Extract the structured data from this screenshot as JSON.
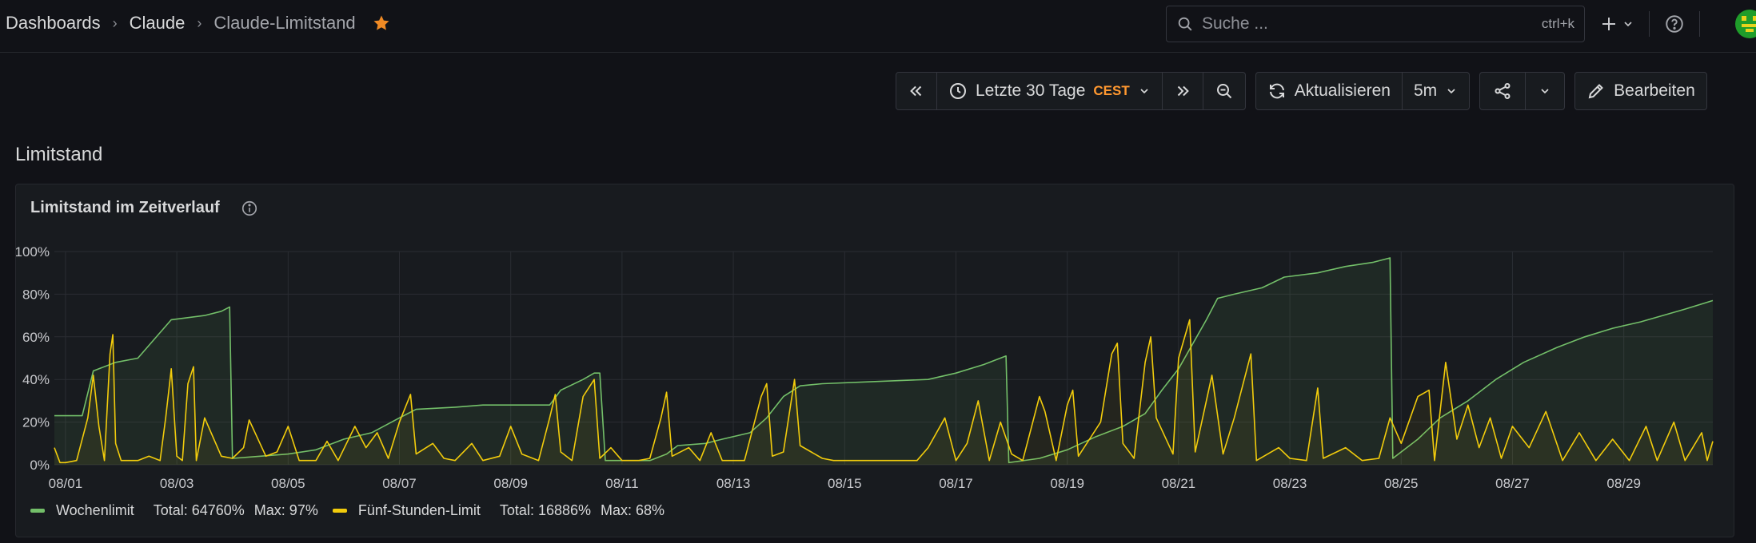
{
  "breadcrumb": {
    "home": "Dashboards",
    "folder": "Claude",
    "dashboard": "Claude-Limitstand"
  },
  "search": {
    "placeholder": "Suche ...",
    "shortcut": "ctrl+k"
  },
  "toolbar": {
    "time_range": "Letzte 30 Tage",
    "timezone": "CEST",
    "refresh_label": "Aktualisieren",
    "refresh_interval": "5m",
    "edit_label": "Bearbeiten"
  },
  "row": {
    "title": "Limitstand"
  },
  "panel": {
    "title": "Limitstand im Zeitverlauf"
  },
  "icons": [
    "search-icon",
    "plus-icon",
    "chevron-down-icon",
    "help-icon",
    "star-icon",
    "chevron-double-left-icon",
    "clock-icon",
    "chevron-double-right-icon",
    "zoom-out-icon",
    "refresh-icon",
    "share-icon",
    "pencil-icon",
    "info-icon"
  ],
  "colors": {
    "accent_star": "#f08a24",
    "timezone": "#ff9830",
    "wochenlimit": "#73bf69",
    "fuenf_stunden": "#f2cc0c"
  },
  "chart_data": {
    "type": "line",
    "y_ticks": [
      "100%",
      "80%",
      "60%",
      "40%",
      "20%",
      "0%"
    ],
    "ylim": [
      0,
      100
    ],
    "x_ticks": [
      "08/01",
      "08/03",
      "08/05",
      "08/07",
      "08/09",
      "08/11",
      "08/13",
      "08/15",
      "08/17",
      "08/19",
      "08/21",
      "08/23",
      "08/25",
      "08/27",
      "08/29"
    ],
    "xlim": [
      0.8,
      30.6
    ],
    "grid": true,
    "legend_position": "bottom-left",
    "series": [
      {
        "name": "Wochenlimit",
        "color": "#73bf69",
        "total": "Total: 64760%",
        "max": "Max: 97%",
        "points": [
          [
            0.8,
            23
          ],
          [
            1.3,
            23
          ],
          [
            1.5,
            44
          ],
          [
            1.9,
            48
          ],
          [
            2.3,
            50
          ],
          [
            2.5,
            56
          ],
          [
            2.7,
            62
          ],
          [
            2.9,
            68
          ],
          [
            3.5,
            70
          ],
          [
            3.8,
            72
          ],
          [
            3.95,
            74
          ],
          [
            4.0,
            3
          ],
          [
            4.5,
            4
          ],
          [
            5.0,
            5
          ],
          [
            5.5,
            7
          ],
          [
            6.0,
            12
          ],
          [
            6.5,
            15
          ],
          [
            7.0,
            22
          ],
          [
            7.3,
            26
          ],
          [
            8.0,
            27
          ],
          [
            8.5,
            28
          ],
          [
            9.7,
            28
          ],
          [
            9.9,
            35
          ],
          [
            10.3,
            40
          ],
          [
            10.5,
            43
          ],
          [
            10.6,
            43
          ],
          [
            10.7,
            2
          ],
          [
            11.5,
            2
          ],
          [
            11.8,
            5
          ],
          [
            12.0,
            9
          ],
          [
            12.5,
            10
          ],
          [
            12.8,
            12
          ],
          [
            13.3,
            15
          ],
          [
            13.6,
            22
          ],
          [
            13.9,
            32
          ],
          [
            14.2,
            37
          ],
          [
            14.6,
            38
          ],
          [
            15.5,
            39
          ],
          [
            16.5,
            40
          ],
          [
            17.0,
            43
          ],
          [
            17.5,
            47
          ],
          [
            17.9,
            51
          ],
          [
            17.95,
            1
          ],
          [
            18.5,
            3
          ],
          [
            19.0,
            7
          ],
          [
            19.5,
            13
          ],
          [
            20.0,
            18
          ],
          [
            20.4,
            24
          ],
          [
            20.7,
            35
          ],
          [
            21.0,
            45
          ],
          [
            21.5,
            68
          ],
          [
            21.7,
            78
          ],
          [
            22.0,
            80
          ],
          [
            22.5,
            83
          ],
          [
            22.9,
            88
          ],
          [
            23.5,
            90
          ],
          [
            24.0,
            93
          ],
          [
            24.5,
            95
          ],
          [
            24.8,
            97
          ],
          [
            24.85,
            3
          ],
          [
            25.3,
            12
          ],
          [
            25.7,
            22
          ],
          [
            26.2,
            30
          ],
          [
            26.7,
            40
          ],
          [
            27.2,
            48
          ],
          [
            27.8,
            55
          ],
          [
            28.3,
            60
          ],
          [
            28.8,
            64
          ],
          [
            29.3,
            67
          ],
          [
            29.7,
            70
          ],
          [
            30.1,
            73
          ],
          [
            30.6,
            77
          ]
        ]
      },
      {
        "name": "Fünf-Stunden-Limit",
        "color": "#f2cc0c",
        "total": "Total: 16886%",
        "max": "Max: 68%",
        "points": [
          [
            0.8,
            8
          ],
          [
            0.9,
            1
          ],
          [
            1.0,
            1
          ],
          [
            1.2,
            2
          ],
          [
            1.4,
            22
          ],
          [
            1.5,
            42
          ],
          [
            1.6,
            18
          ],
          [
            1.7,
            2
          ],
          [
            1.8,
            52
          ],
          [
            1.85,
            61
          ],
          [
            1.9,
            10
          ],
          [
            2.0,
            2
          ],
          [
            2.3,
            2
          ],
          [
            2.5,
            4
          ],
          [
            2.7,
            2
          ],
          [
            2.8,
            22
          ],
          [
            2.9,
            45
          ],
          [
            3.0,
            4
          ],
          [
            3.1,
            2
          ],
          [
            3.2,
            38
          ],
          [
            3.3,
            46
          ],
          [
            3.35,
            2
          ],
          [
            3.5,
            22
          ],
          [
            3.8,
            4
          ],
          [
            4.0,
            3
          ],
          [
            4.2,
            8
          ],
          [
            4.3,
            21
          ],
          [
            4.6,
            4
          ],
          [
            4.8,
            6
          ],
          [
            5.0,
            18
          ],
          [
            5.2,
            2
          ],
          [
            5.5,
            2
          ],
          [
            5.7,
            11
          ],
          [
            5.9,
            2
          ],
          [
            6.2,
            18
          ],
          [
            6.4,
            8
          ],
          [
            6.6,
            15
          ],
          [
            6.8,
            3
          ],
          [
            7.0,
            20
          ],
          [
            7.2,
            33
          ],
          [
            7.3,
            5
          ],
          [
            7.6,
            10
          ],
          [
            7.8,
            3
          ],
          [
            8.0,
            2
          ],
          [
            8.3,
            10
          ],
          [
            8.5,
            2
          ],
          [
            8.8,
            4
          ],
          [
            9.0,
            18
          ],
          [
            9.2,
            5
          ],
          [
            9.5,
            2
          ],
          [
            9.7,
            22
          ],
          [
            9.8,
            33
          ],
          [
            9.9,
            6
          ],
          [
            10.1,
            2
          ],
          [
            10.3,
            32
          ],
          [
            10.5,
            40
          ],
          [
            10.6,
            3
          ],
          [
            10.8,
            8
          ],
          [
            11.0,
            2
          ],
          [
            11.3,
            2
          ],
          [
            11.5,
            3
          ],
          [
            11.7,
            22
          ],
          [
            11.8,
            34
          ],
          [
            11.9,
            4
          ],
          [
            12.2,
            8
          ],
          [
            12.4,
            2
          ],
          [
            12.6,
            15
          ],
          [
            12.8,
            2
          ],
          [
            13.2,
            2
          ],
          [
            13.5,
            32
          ],
          [
            13.6,
            38
          ],
          [
            13.7,
            4
          ],
          [
            13.9,
            6
          ],
          [
            14.1,
            40
          ],
          [
            14.2,
            9
          ],
          [
            14.4,
            6
          ],
          [
            14.6,
            3
          ],
          [
            14.8,
            2
          ],
          [
            15.2,
            2
          ],
          [
            15.6,
            2
          ],
          [
            16.0,
            2
          ],
          [
            16.3,
            2
          ],
          [
            16.5,
            8
          ],
          [
            16.8,
            22
          ],
          [
            17.0,
            2
          ],
          [
            17.2,
            10
          ],
          [
            17.4,
            30
          ],
          [
            17.6,
            2
          ],
          [
            17.8,
            20
          ],
          [
            18.0,
            5
          ],
          [
            18.2,
            2
          ],
          [
            18.5,
            32
          ],
          [
            18.6,
            25
          ],
          [
            18.8,
            2
          ],
          [
            19.0,
            28
          ],
          [
            19.1,
            35
          ],
          [
            19.2,
            4
          ],
          [
            19.4,
            12
          ],
          [
            19.6,
            20
          ],
          [
            19.8,
            52
          ],
          [
            19.9,
            57
          ],
          [
            20.0,
            10
          ],
          [
            20.2,
            3
          ],
          [
            20.4,
            48
          ],
          [
            20.5,
            60
          ],
          [
            20.6,
            22
          ],
          [
            20.9,
            5
          ],
          [
            21.0,
            50
          ],
          [
            21.2,
            68
          ],
          [
            21.3,
            6
          ],
          [
            21.6,
            42
          ],
          [
            21.8,
            5
          ],
          [
            22.0,
            22
          ],
          [
            22.3,
            52
          ],
          [
            22.4,
            2
          ],
          [
            22.8,
            8
          ],
          [
            23.0,
            3
          ],
          [
            23.3,
            2
          ],
          [
            23.5,
            36
          ],
          [
            23.6,
            3
          ],
          [
            24.0,
            8
          ],
          [
            24.3,
            2
          ],
          [
            24.6,
            3
          ],
          [
            24.8,
            22
          ],
          [
            25.0,
            10
          ],
          [
            25.3,
            32
          ],
          [
            25.5,
            35
          ],
          [
            25.6,
            2
          ],
          [
            25.8,
            48
          ],
          [
            26.0,
            12
          ],
          [
            26.2,
            28
          ],
          [
            26.4,
            8
          ],
          [
            26.6,
            22
          ],
          [
            26.8,
            3
          ],
          [
            27.0,
            18
          ],
          [
            27.3,
            8
          ],
          [
            27.6,
            25
          ],
          [
            27.9,
            2
          ],
          [
            28.2,
            15
          ],
          [
            28.5,
            2
          ],
          [
            28.8,
            12
          ],
          [
            29.1,
            2
          ],
          [
            29.4,
            18
          ],
          [
            29.6,
            2
          ],
          [
            29.9,
            20
          ],
          [
            30.1,
            2
          ],
          [
            30.4,
            15
          ],
          [
            30.5,
            2
          ],
          [
            30.6,
            11
          ]
        ]
      }
    ]
  }
}
